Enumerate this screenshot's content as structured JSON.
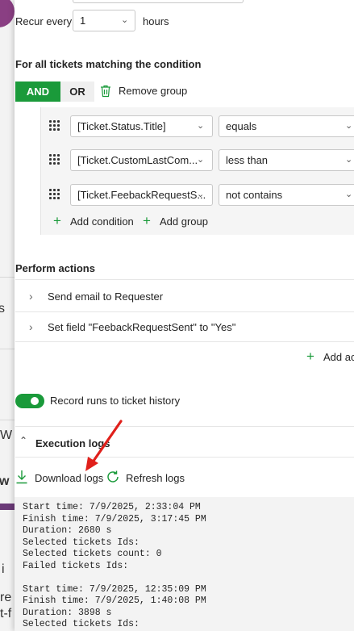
{
  "background": {
    "fragments": [
      "s",
      "W",
      "w",
      "i",
      "re",
      "t-f"
    ]
  },
  "recurrence": {
    "label": "Recur every",
    "value": "1",
    "unit": "hours"
  },
  "condition_section": {
    "title": "For all tickets matching the condition",
    "and_label": "AND",
    "or_label": "OR",
    "remove_group_label": "Remove group",
    "rows": [
      {
        "field": "[Ticket.Status.Title]",
        "operator": "equals"
      },
      {
        "field": "[Ticket.CustomLastCom...",
        "operator": "less than"
      },
      {
        "field": "[Ticket.FeebackRequestS...",
        "operator": "not contains"
      }
    ],
    "add_condition_label": "Add condition",
    "add_group_label": "Add group"
  },
  "actions_section": {
    "title": "Perform actions",
    "actions": [
      {
        "label": "Send email to Requester"
      },
      {
        "label": "Set field \"FeebackRequestSent\" to \"Yes\""
      }
    ],
    "add_action_label": "Add ac"
  },
  "record_runs": {
    "label": "Record runs to ticket history",
    "enabled": true
  },
  "execution_logs": {
    "title": "Execution logs",
    "download_label": "Download logs",
    "refresh_label": "Refresh logs",
    "log_lines": [
      "Start time: 7/9/2025, 2:33:04 PM",
      "Finish time: 7/9/2025, 3:17:45 PM",
      "Duration: 2680 s",
      "Selected tickets Ids:",
      "Selected tickets count: 0",
      "Failed tickets Ids:",
      "",
      "Start time: 7/9/2025, 12:35:09 PM",
      "Finish time: 7/9/2025, 1:40:08 PM",
      "Duration: 3898 s",
      "Selected tickets Ids:"
    ]
  },
  "colors": {
    "accent_green": "#1a9a3a",
    "annotation_red": "#e0201b"
  }
}
